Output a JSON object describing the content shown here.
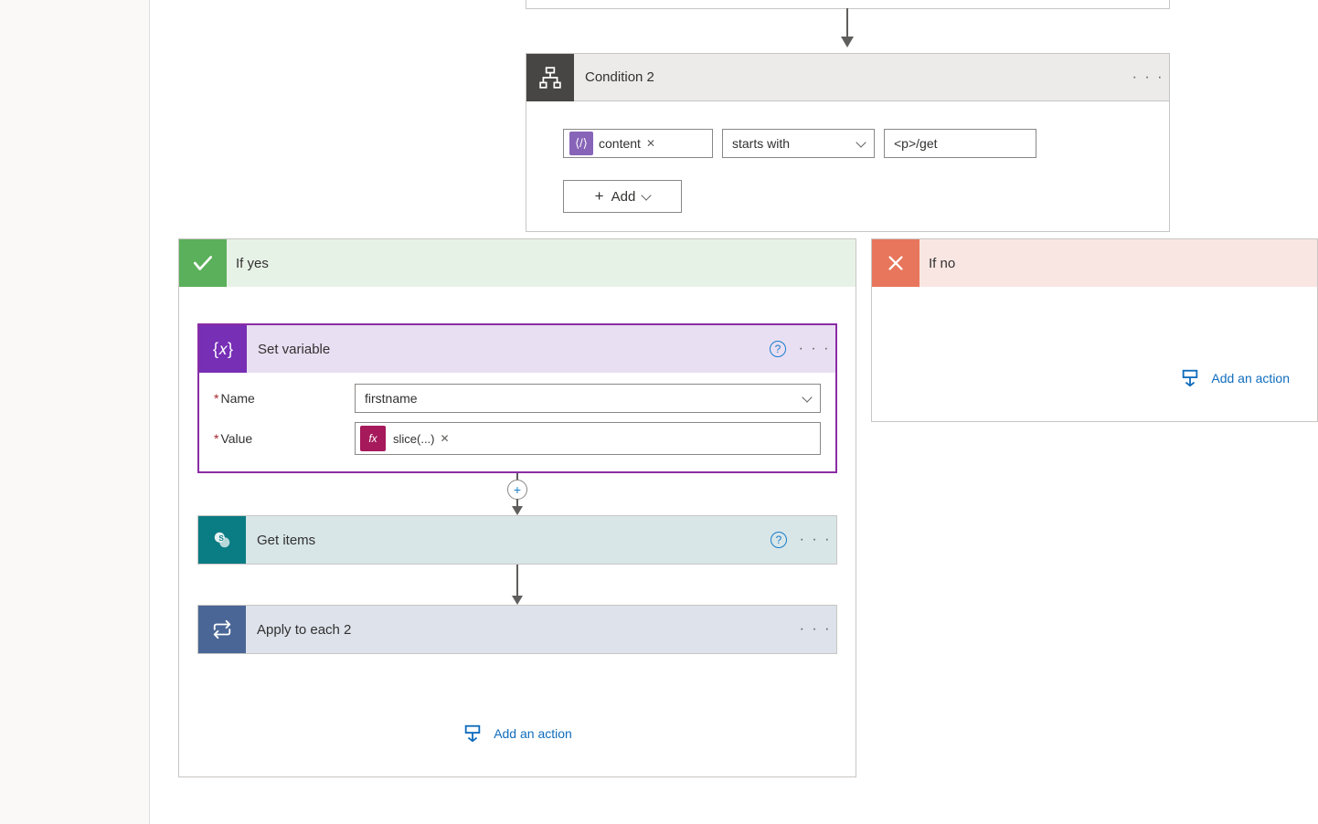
{
  "condition": {
    "title": "Condition 2",
    "token_label": "content",
    "operator": "starts with",
    "value": "<p>/get",
    "add_label": "Add"
  },
  "branches": {
    "yes_label": "If yes",
    "no_label": "If no"
  },
  "set_variable": {
    "title": "Set variable",
    "name_label": "Name",
    "name_value": "firstname",
    "value_label": "Value",
    "value_token": "slice(...)"
  },
  "get_items": {
    "title": "Get items"
  },
  "apply_each": {
    "title": "Apply to each 2"
  },
  "buttons": {
    "add_action": "Add an action"
  },
  "glyph": {
    "x": "✕",
    "plus": "+",
    "dots": "· · ·",
    "help": "?",
    "fx": "fx",
    "varcurly": "{𝑥}",
    "content": "⟨/⟩"
  }
}
